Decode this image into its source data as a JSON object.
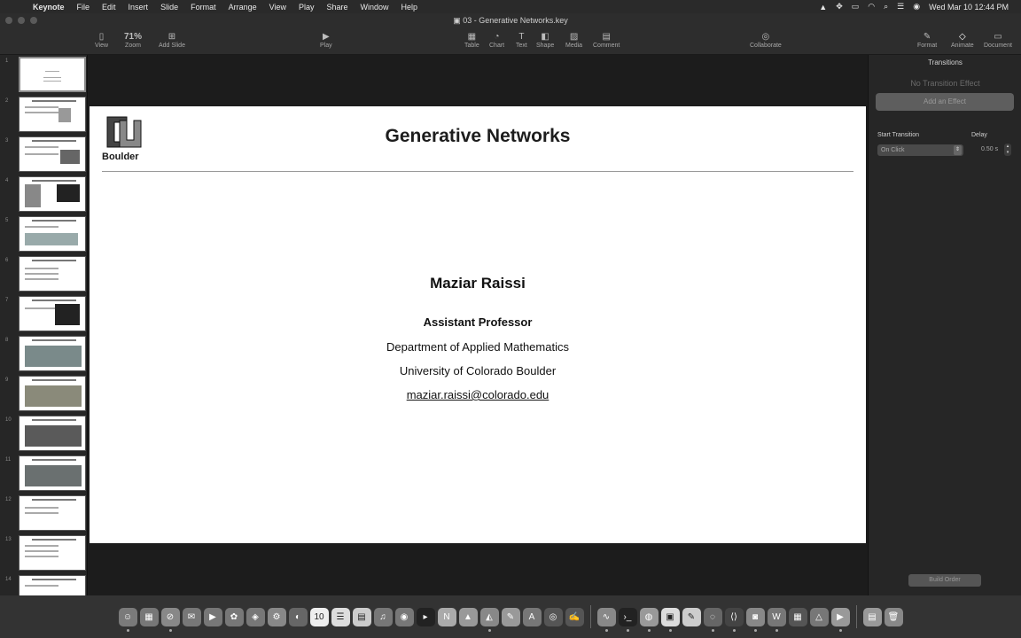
{
  "menubar": {
    "app_name": "Keynote",
    "items": [
      "File",
      "Edit",
      "Insert",
      "Slide",
      "Format",
      "Arrange",
      "View",
      "Play",
      "Share",
      "Window",
      "Help"
    ],
    "status_icons": [
      "upload-icon",
      "puzzle-icon",
      "battery-icon",
      "wifi-icon",
      "search-icon",
      "control-center-icon",
      "siri-icon"
    ],
    "clock": "Wed Mar 10  12:44 PM"
  },
  "toolbar": {
    "document_title": "03 - Generative Networks.key",
    "view_label": "View",
    "zoom_value": "71%",
    "zoom_label": "Zoom",
    "add_slide_label": "Add Slide",
    "play_label": "Play",
    "table_label": "Table",
    "chart_label": "Chart",
    "text_label": "Text",
    "shape_label": "Shape",
    "media_label": "Media",
    "comment_label": "Comment",
    "collaborate_label": "Collaborate",
    "format_label": "Format",
    "animate_label": "Animate",
    "document_label": "Document"
  },
  "navigator": {
    "slide_numbers": [
      "1",
      "2",
      "3",
      "4",
      "5",
      "6",
      "7",
      "8",
      "9",
      "10",
      "11",
      "12",
      "13",
      "14"
    ]
  },
  "slide": {
    "logo_text": "Boulder",
    "title": "Generative Networks",
    "author": "Maziar Raissi",
    "role": "Assistant Professor",
    "department": "Department of Applied Mathematics",
    "university": "University of Colorado Boulder",
    "email": "maziar.raissi@colorado.edu"
  },
  "inspector": {
    "header": "Transitions",
    "no_effect": "No Transition Effect",
    "add_effect_label": "Add an Effect",
    "start_transition_label": "Start Transition",
    "delay_label": "Delay",
    "start_value": "On Click",
    "delay_value": "0.50 s",
    "build_order_label": "Build Order"
  },
  "dock": {
    "calendar_day": "10"
  }
}
